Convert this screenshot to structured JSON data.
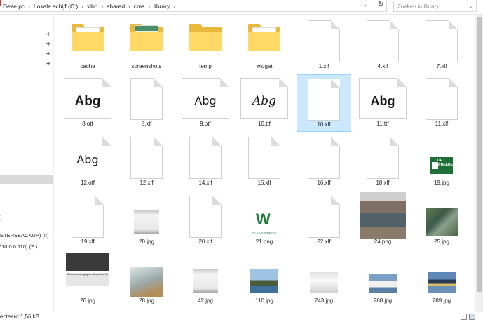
{
  "address": {
    "crumbs": [
      "Deze pc",
      "Lokale schijf (C:)",
      "xibo",
      "shared",
      "cms",
      "library"
    ],
    "search_placeholder": "Zoeken in library"
  },
  "sidebar": {
    "item_backup": "ETERSBACKUP) (I:)",
    "item_network": "\\10.0.0.110) (Z:)",
    "item_paren": ")"
  },
  "status": {
    "text": "ecteerd  1,56 kB"
  },
  "files": [
    {
      "name": "cache",
      "kind": "folder"
    },
    {
      "name": "screenshots",
      "kind": "folder-img"
    },
    {
      "name": "temp",
      "kind": "folder-empty"
    },
    {
      "name": "widget",
      "kind": "folder"
    },
    {
      "name": "1.xlf",
      "kind": "page"
    },
    {
      "name": "4.xlf",
      "kind": "page"
    },
    {
      "name": "7.xlf",
      "kind": "page"
    },
    {
      "name": "8.otf",
      "kind": "font",
      "style": "bold"
    },
    {
      "name": "8.xlf",
      "kind": "page"
    },
    {
      "name": "9.otf",
      "kind": "font",
      "style": "light"
    },
    {
      "name": "10.ttf",
      "kind": "font",
      "style": "script"
    },
    {
      "name": "10.xlf",
      "kind": "page",
      "selected": true
    },
    {
      "name": "11.ttf",
      "kind": "font",
      "style": "semibold"
    },
    {
      "name": "11.xlf",
      "kind": "page"
    },
    {
      "name": "12.otf",
      "kind": "font",
      "style": "light"
    },
    {
      "name": "12.xlf",
      "kind": "page"
    },
    {
      "name": "14.xlf",
      "kind": "page"
    },
    {
      "name": "15.xlf",
      "kind": "page"
    },
    {
      "name": "16.xlf",
      "kind": "page"
    },
    {
      "name": "18.xlf",
      "kind": "page"
    },
    {
      "name": "19.jpg",
      "kind": "img-sign"
    },
    {
      "name": "19.xlf",
      "kind": "page"
    },
    {
      "name": "20.jpg",
      "kind": "img-white"
    },
    {
      "name": "20.xlf",
      "kind": "page"
    },
    {
      "name": "21.png",
      "kind": "img-logo"
    },
    {
      "name": "22.xlf",
      "kind": "page"
    },
    {
      "name": "24.png",
      "kind": "img-rowers"
    },
    {
      "name": "25.jpg",
      "kind": "img-aerial"
    },
    {
      "name": "26.jpg",
      "kind": "img-news"
    },
    {
      "name": "28.jpg",
      "kind": "img-boat"
    },
    {
      "name": "42.jpg",
      "kind": "img-white"
    },
    {
      "name": "110.jpg",
      "kind": "img-people"
    },
    {
      "name": "243.jpg",
      "kind": "img-whitesmall"
    },
    {
      "name": "288.jpg",
      "kind": "img-crew"
    },
    {
      "name": "289.jpg",
      "kind": "img-single"
    }
  ],
  "font_sample": "Abg",
  "logo_caption": "P.T.V. DE WHEERE",
  "sign_text": "DE WHEERE",
  "news_caption": "Roeiers vereniging op vlakgebouw De Wheere"
}
